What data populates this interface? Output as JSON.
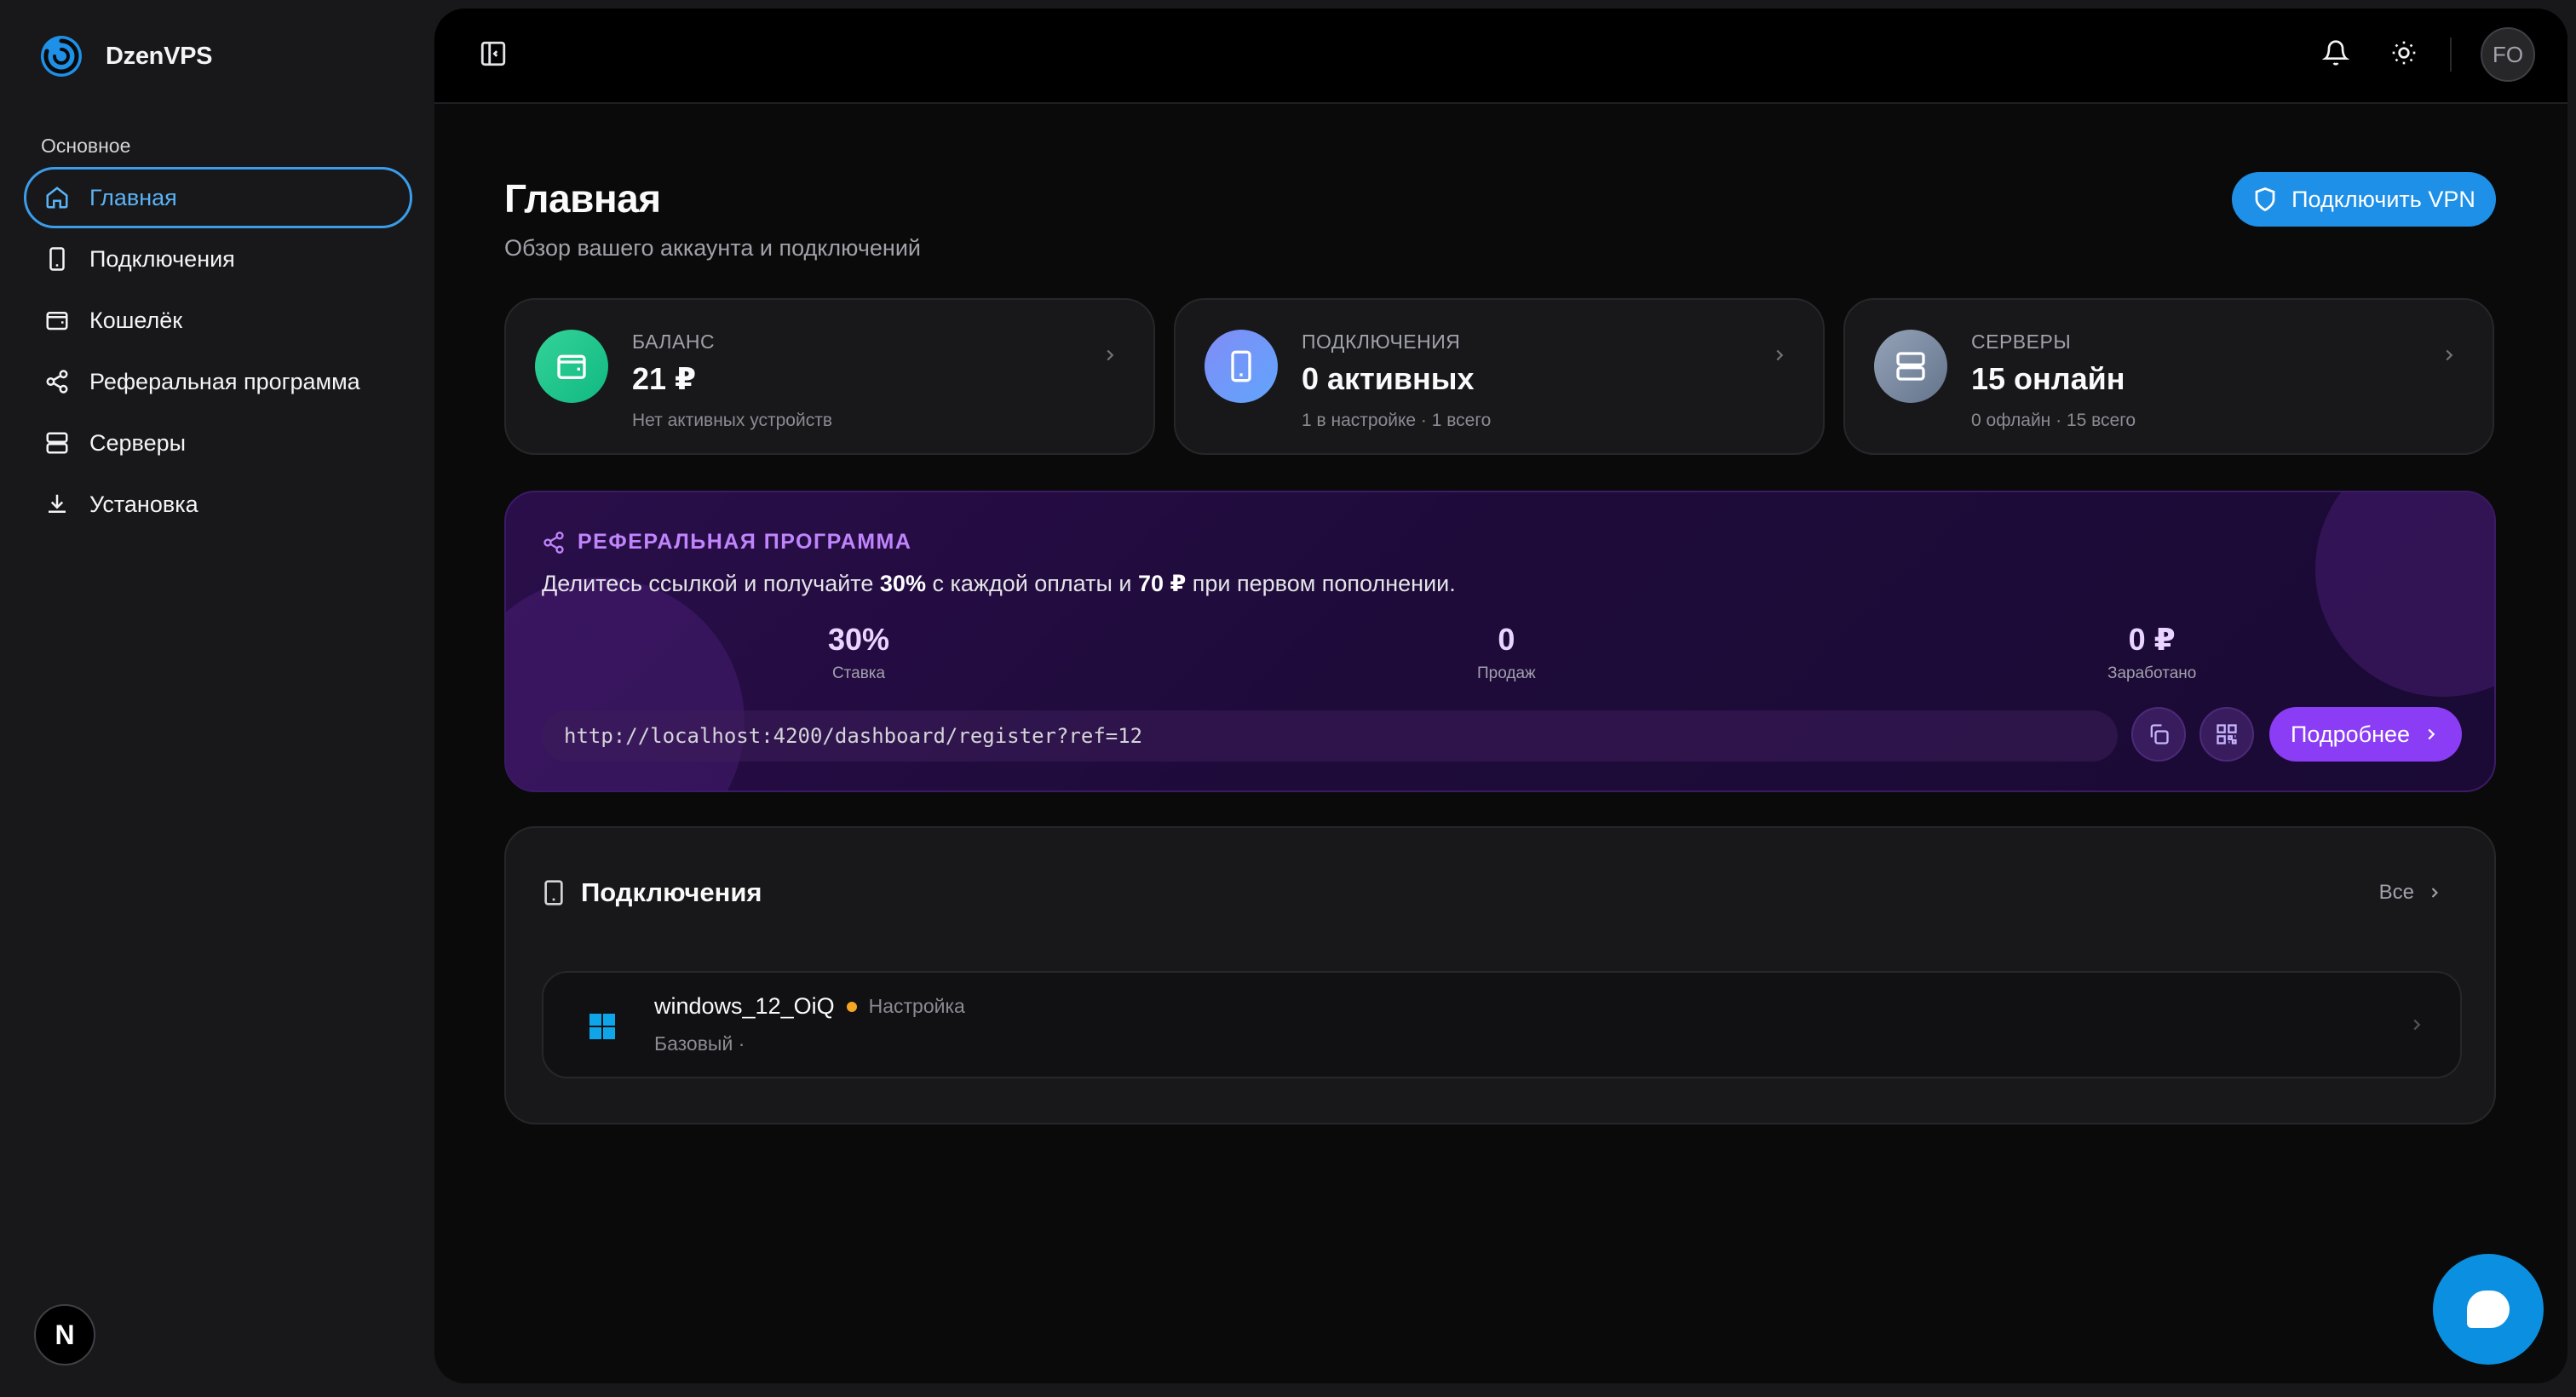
{
  "brand": {
    "name": "DzenVPS",
    "accent": "#3b9dea"
  },
  "sidebar": {
    "section": "Основное",
    "items": [
      {
        "label": "Главная",
        "icon": "home-icon",
        "active": true
      },
      {
        "label": "Подключения",
        "icon": "device-icon"
      },
      {
        "label": "Кошелёк",
        "icon": "wallet-icon"
      },
      {
        "label": "Реферальная программа",
        "icon": "share-icon"
      },
      {
        "label": "Серверы",
        "icon": "server-icon"
      },
      {
        "label": "Установка",
        "icon": "download-icon"
      }
    ],
    "bottom_badge": "N"
  },
  "topbar": {
    "avatar": "FO",
    "icons": [
      "bell-icon",
      "sun-icon"
    ]
  },
  "page": {
    "title": "Главная",
    "subtitle": "Обзор вашего аккаунта и подключений",
    "vpn_button": "Подключить VPN"
  },
  "stats": [
    {
      "label": "БАЛАНС",
      "value": "21 ₽",
      "meta": "Нет активных устройств",
      "icon": "wallet-icon",
      "color": "#10b981"
    },
    {
      "label": "ПОДКЛЮЧЕНИЯ",
      "value": "0 активных",
      "meta": "1 в настройке · 1 всего",
      "icon": "device-icon",
      "color": "#6366f1"
    },
    {
      "label": "СЕРВЕРЫ",
      "value": "15 онлайн",
      "meta": "0 офлайн · 15 всего",
      "icon": "server-icon",
      "color": "#64748b"
    }
  ],
  "referral": {
    "title": "РЕФЕРАЛЬНАЯ ПРОГРАММА",
    "desc_pre": "Делитесь ссылкой и получайте ",
    "desc_pct": "30%",
    "desc_mid": " с каждой оплаты и ",
    "desc_bonus": "70 ₽",
    "desc_post": " при первом пополнении.",
    "stats": [
      {
        "value": "30%",
        "label": "Ставка"
      },
      {
        "value": "0",
        "label": "Продаж"
      },
      {
        "value": "0 ₽",
        "label": "Заработано"
      }
    ],
    "link": "http://localhost:4200/dashboard/register?ref=12",
    "more_button": "Подробнее",
    "accent": "#8b3cf5"
  },
  "connections": {
    "title": "Подключения",
    "all_link": "Все",
    "items": [
      {
        "name": "windows_12_OiQ",
        "status": "Настройка",
        "plan": "Базовый ·",
        "status_color": "#f5a524",
        "os_icon": "windows-icon"
      }
    ]
  }
}
